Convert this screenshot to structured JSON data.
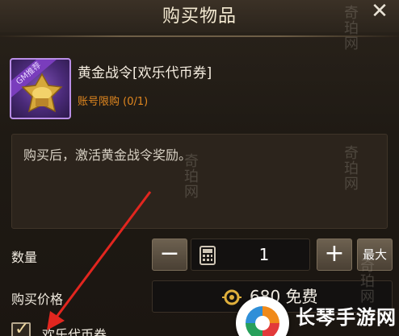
{
  "dialog": {
    "title": "购买物品",
    "close_icon": "close-icon"
  },
  "item": {
    "ribbon": "GM推荐",
    "name": "黄金战令[欢乐代币券]",
    "limit": "账号限购 (0/1)",
    "border_color": "#b98de6"
  },
  "description": "购买后，激活黄金战令奖励。",
  "quantity": {
    "label": "数量",
    "minus": "−",
    "value": "1",
    "plus": "+",
    "max": "最大"
  },
  "price": {
    "label": "购买价格",
    "value": "680 免费"
  },
  "pay_option": {
    "label": "欢乐代币券",
    "checked": true
  },
  "watermarks": [
    "奇珀网",
    "奇珀网",
    "奇珀网",
    "奇珀网"
  ],
  "site_logo": {
    "text": "长琴手游网"
  },
  "colors": {
    "accent_orange": "#e0871f",
    "arrow_red": "#e2261f"
  }
}
